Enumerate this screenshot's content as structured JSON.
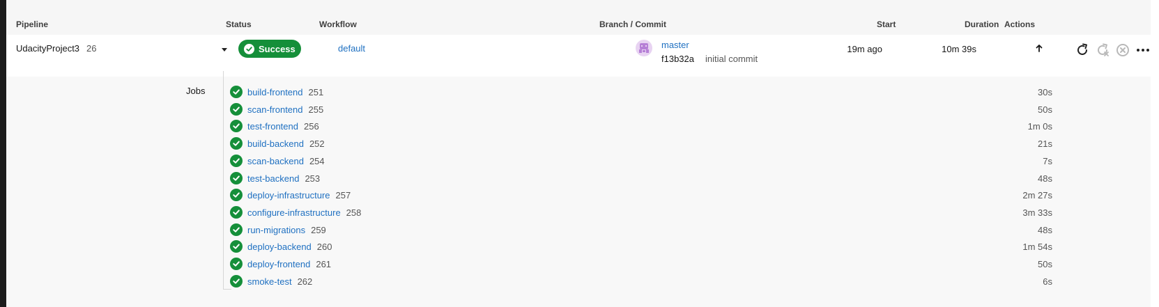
{
  "header": {
    "pipeline": "Pipeline",
    "status": "Status",
    "workflow": "Workflow",
    "branch_commit": "Branch / Commit",
    "start": "Start",
    "duration": "Duration",
    "actions": "Actions"
  },
  "pipeline": {
    "name": "UdacityProject3",
    "number": "26",
    "status": "Success",
    "status_color": "#158f3a",
    "workflow": "default",
    "branch": "master",
    "commit_hash": "f13b32a",
    "commit_message": "initial commit",
    "start": "19m ago",
    "duration": "10m 39s"
  },
  "jobs_label": "Jobs",
  "jobs": [
    {
      "name": "build-frontend",
      "number": "251",
      "duration": "30s"
    },
    {
      "name": "scan-frontend",
      "number": "255",
      "duration": "50s"
    },
    {
      "name": "test-frontend",
      "number": "256",
      "duration": "1m 0s"
    },
    {
      "name": "build-backend",
      "number": "252",
      "duration": "21s"
    },
    {
      "name": "scan-backend",
      "number": "254",
      "duration": "7s"
    },
    {
      "name": "test-backend",
      "number": "253",
      "duration": "48s"
    },
    {
      "name": "deploy-infrastructure",
      "number": "257",
      "duration": "2m 27s"
    },
    {
      "name": "configure-infrastructure",
      "number": "258",
      "duration": "3m 33s"
    },
    {
      "name": "run-migrations",
      "number": "259",
      "duration": "48s"
    },
    {
      "name": "deploy-backend",
      "number": "260",
      "duration": "1m 54s"
    },
    {
      "name": "deploy-frontend",
      "number": "261",
      "duration": "50s"
    },
    {
      "name": "smoke-test",
      "number": "262",
      "duration": "6s"
    }
  ],
  "icons": {
    "status": "check-circle-icon",
    "expand": "chevron-down-icon",
    "avatar": "user-avatar-icon",
    "duration_arrow": "arrow-up-icon",
    "rerun": "rerun-icon",
    "rerun_failed": "rerun-failed-icon",
    "cancel": "cancel-icon",
    "more": "more-options-icon"
  },
  "colors": {
    "success": "#158f3a",
    "link": "#1f70c1"
  }
}
